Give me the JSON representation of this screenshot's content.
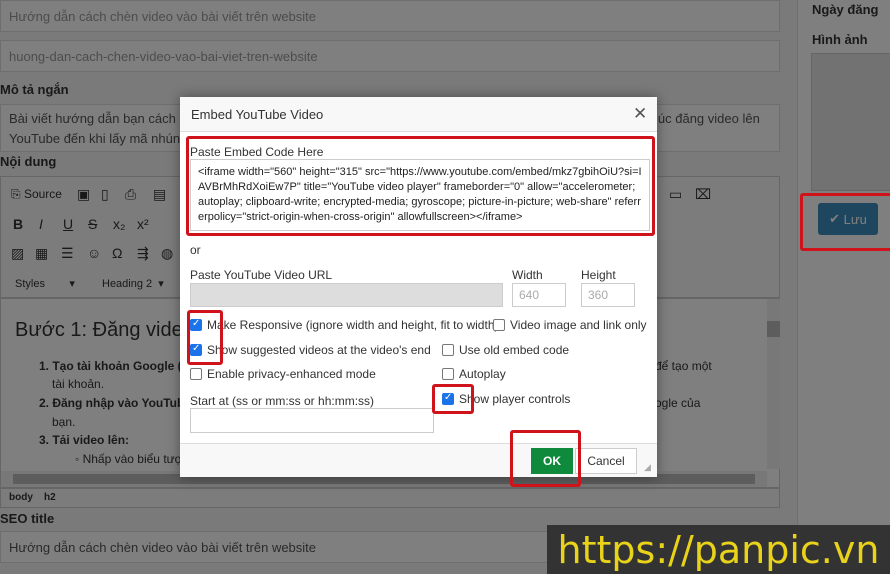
{
  "page": {
    "title_value": "Hướng dẫn cách chèn video vào bài viết trên website",
    "slug_value": "huong-dan-cach-chen-video-vao-bai-viet-tren-website",
    "short_desc_label": "Mô tả ngắn",
    "short_desc_line1_left": "Bài viết hướng dẫn bạn cách c",
    "short_desc_line1_right": "lúc đăng video lên",
    "short_desc_line2": "YouTube đến khi lấy mã nhúng",
    "content_label": "Nội dung",
    "toolbar": {
      "source": "Source",
      "styles": "Styles",
      "format": "Heading 2"
    },
    "editor": {
      "heading": "Bước 1: Đăng video l",
      "li1": "1. Tạo tài khoản Google (",
      "li1_right": "để tạo một",
      "li1_cont": "tài khoản.",
      "li2": "2. Đăng nhập vào YouTub",
      "li2_right": "ogle của",
      "li2_cont": "bạn.",
      "li3": "3. Tải video lên:",
      "li3_sub": "Nhấp vào biểu tượ"
    },
    "path": [
      "body",
      "h2"
    ],
    "seo_label": "SEO title",
    "seo_value": "Hướng dẫn cách chèn video vào bài viết trên website"
  },
  "sidebar": {
    "date_label": "Ngày đăng",
    "image_label": "Hình ảnh",
    "save": "Lưu"
  },
  "dialog": {
    "title": "Embed YouTube Video",
    "embed_label": "Paste Embed Code Here",
    "embed_code": "<iframe width=\"560\" height=\"315\" src=\"https://www.youtube.com/embed/mkz7gbihOiU?si=IAVBrMhRdXoiEw7P\" title=\"YouTube video player\" frameborder=\"0\" allow=\"accelerometer; autoplay; clipboard-write; encrypted-media; gyroscope; picture-in-picture; web-share\" referrerpolicy=\"strict-origin-when-cross-origin\" allowfullscreen></iframe>",
    "or": "or",
    "url_label": "Paste YouTube Video URL",
    "width_label": "Width",
    "width_placeholder": "640",
    "height_label": "Height",
    "height_placeholder": "360",
    "options": [
      {
        "label": "Make Responsive (ignore width and height, fit to width)",
        "checked": true
      },
      {
        "label": "Video image and link only",
        "checked": false
      },
      {
        "label": "Show suggested videos at the video's end",
        "checked": true
      },
      {
        "label": "Use old embed code",
        "checked": false
      },
      {
        "label": "Enable privacy-enhanced mode",
        "checked": false
      },
      {
        "label": "Autoplay",
        "checked": false
      },
      {
        "label": "Show player controls",
        "checked": true
      }
    ],
    "start_label": "Start at (ss or mm:ss or hh:mm:ss)",
    "ok": "OK",
    "cancel": "Cancel"
  },
  "watermark": "https://panpic.vn",
  "colors": {
    "highlight": "#d0121b",
    "ok": "#0f8a3c",
    "save": "#3c8dbc",
    "watermark": "#e8d21a"
  }
}
